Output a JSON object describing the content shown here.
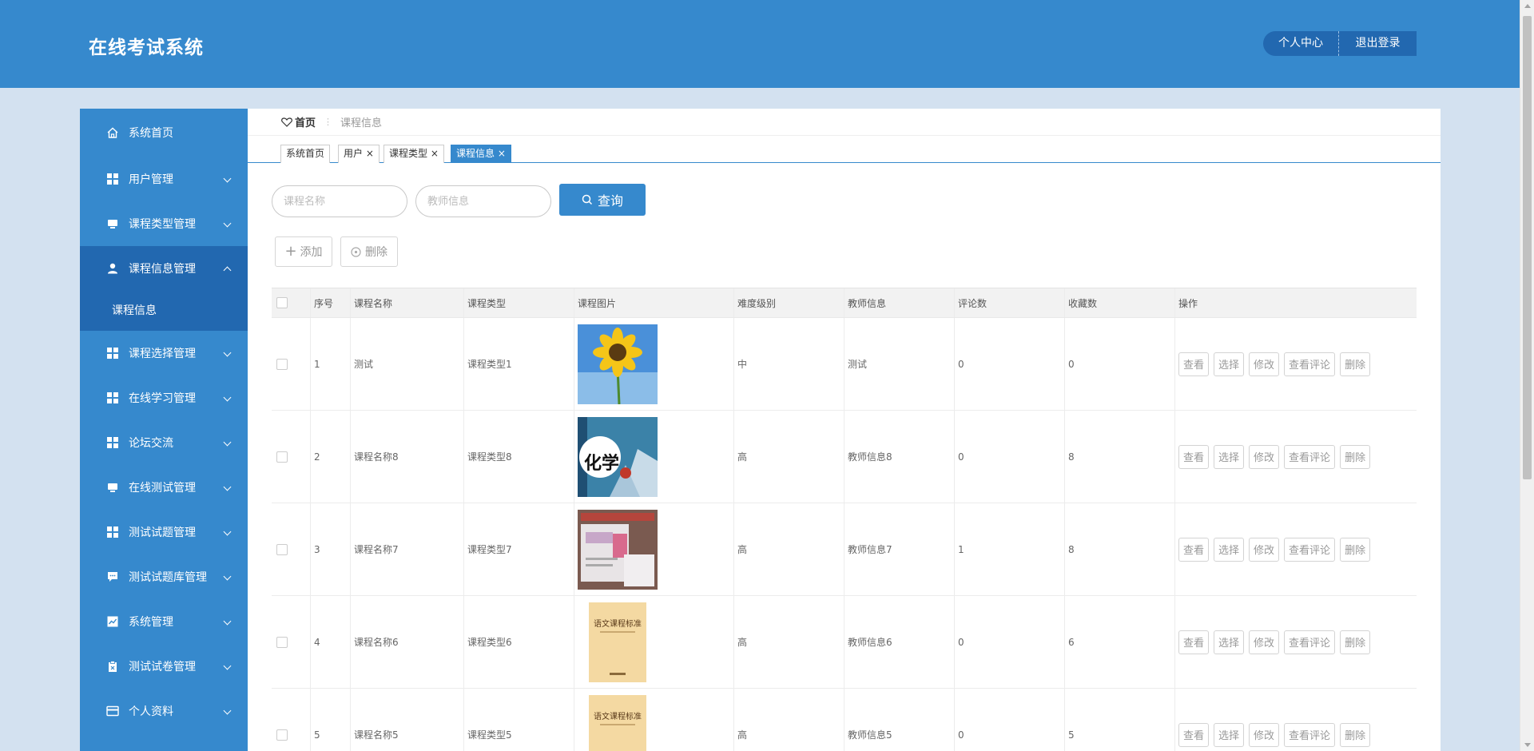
{
  "header": {
    "title": "在线考试系统",
    "profile_label": "个人中心",
    "logout_label": "退出登录"
  },
  "sidebar": {
    "items": [
      {
        "label": "系统首页",
        "icon": "home-icon"
      },
      {
        "label": "用户管理",
        "icon": "grid-icon"
      },
      {
        "label": "课程类型管理",
        "icon": "monitor-icon"
      },
      {
        "label": "课程信息管理",
        "icon": "user-icon",
        "active": true
      },
      {
        "label": "课程选择管理",
        "icon": "grid-icon"
      },
      {
        "label": "在线学习管理",
        "icon": "grid-icon"
      },
      {
        "label": "论坛交流",
        "icon": "grid-icon"
      },
      {
        "label": "在线测试管理",
        "icon": "monitor-icon"
      },
      {
        "label": "测试试题管理",
        "icon": "grid-icon"
      },
      {
        "label": "测试试题库管理",
        "icon": "chat-icon"
      },
      {
        "label": "系统管理",
        "icon": "chart-icon"
      },
      {
        "label": "测试试卷管理",
        "icon": "clipboard-icon"
      },
      {
        "label": "个人资料",
        "icon": "card-icon"
      }
    ],
    "submenu": {
      "label": "课程信息"
    }
  },
  "breadcrumb": {
    "home": "首页",
    "current": "课程信息"
  },
  "tabs": [
    {
      "label": "系统首页",
      "closable": false
    },
    {
      "label": "用户",
      "closable": true
    },
    {
      "label": "课程类型",
      "closable": true
    },
    {
      "label": "课程信息",
      "closable": true,
      "active": true
    }
  ],
  "search": {
    "course_placeholder": "课程名称",
    "teacher_placeholder": "教师信息",
    "button_label": "查询"
  },
  "actions": {
    "add_label": "添加",
    "delete_label": "删除"
  },
  "table": {
    "headers": [
      "序号",
      "课程名称",
      "课程类型",
      "课程图片",
      "难度级别",
      "教师信息",
      "评论数",
      "收藏数",
      "操作"
    ],
    "rows": [
      {
        "index": "1",
        "name": "测试",
        "type": "课程类型1",
        "image": "sunflower",
        "level": "中",
        "teacher": "测试",
        "comments": "0",
        "favorites": "0"
      },
      {
        "index": "2",
        "name": "课程名称8",
        "type": "课程类型8",
        "image": "chemistry-book",
        "image_text": "化学",
        "level": "高",
        "teacher": "教师信息8",
        "comments": "0",
        "favorites": "8"
      },
      {
        "index": "3",
        "name": "课程名称7",
        "type": "课程类型7",
        "image": "english-books",
        "level": "高",
        "teacher": "教师信息7",
        "comments": "1",
        "favorites": "8"
      },
      {
        "index": "4",
        "name": "课程名称6",
        "type": "课程类型6",
        "image": "chinese-standard-book",
        "image_text": "语文课程标准",
        "level": "高",
        "teacher": "教师信息6",
        "comments": "0",
        "favorites": "6"
      },
      {
        "index": "5",
        "name": "课程名称5",
        "type": "课程类型5",
        "image": "chinese-standard-book",
        "image_text": "语文课程标准",
        "level": "高",
        "teacher": "教师信息5",
        "comments": "0",
        "favorites": "5"
      }
    ],
    "ops": [
      "查看",
      "选择",
      "修改",
      "查看评论",
      "删除"
    ]
  },
  "colors": {
    "primary": "#3689cd",
    "primary_dark": "#2268b0",
    "page_bg": "#d3e1f0"
  }
}
